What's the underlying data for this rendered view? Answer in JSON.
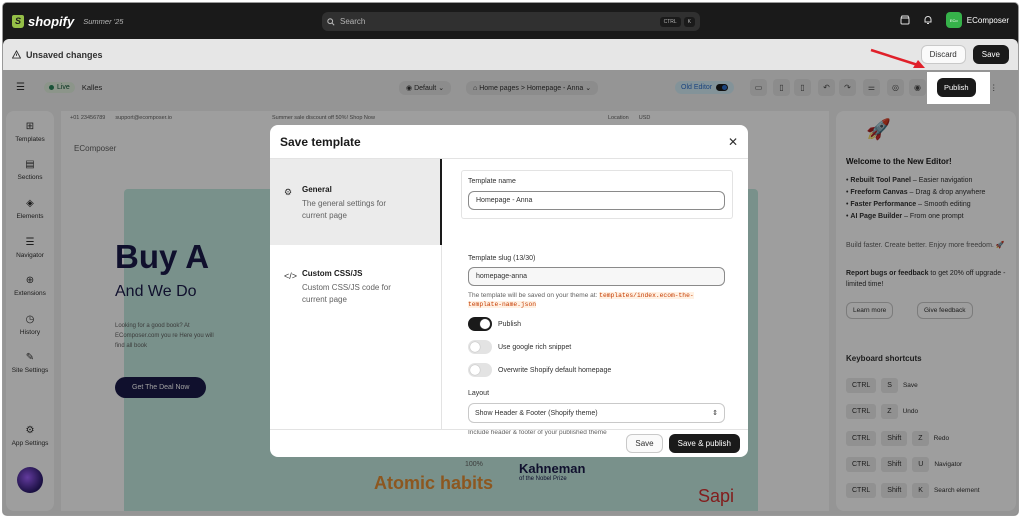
{
  "shopify": {
    "logo_word": "shopify",
    "summer": "Summer '25",
    "search_placeholder": "Search",
    "kbd1": "CTRL",
    "kbd2": "K",
    "store_badge": "ECo",
    "store_name": "EComposer"
  },
  "unsaved": {
    "text": "Unsaved changes",
    "discard": "Discard",
    "save": "Save"
  },
  "toolbar": {
    "live": "Live",
    "theme": "Kalles",
    "default": "Default",
    "breadcrumb": "Home pages > Homepage - Anna",
    "old_editor": "Old Editor",
    "publish": "Publish"
  },
  "sidebar": [
    {
      "label": "Templates",
      "glyph": "⊞"
    },
    {
      "label": "Sections",
      "glyph": "▤"
    },
    {
      "label": "Elements",
      "glyph": "◈"
    },
    {
      "label": "Navigator",
      "glyph": "☰"
    },
    {
      "label": "Extensions",
      "glyph": "⊕"
    },
    {
      "label": "History",
      "glyph": "◷"
    },
    {
      "label": "Site Settings",
      "glyph": "✎"
    },
    {
      "label": "App Settings",
      "glyph": "⚙"
    }
  ],
  "canvas": {
    "phone": "+01 23456789",
    "email": "support@ecomposer.io",
    "promo": "Summer sale discount off 50%! Shop Now",
    "location": "Location",
    "currency": "USD",
    "brand": "EComposer",
    "hero_h1": "Buy A",
    "hero_h2": "And We Do",
    "hero_p": "Looking for a good book? At EComposer.com you re Here you will find all book",
    "deal": "Get The Deal Now",
    "zoom": "100%",
    "book1": "Kahneman",
    "book1_sub": "of the Nobel Prize",
    "book2": "Atomic habits",
    "book3": "Sapi"
  },
  "right_panel": {
    "welcome": "Welcome to the New Editor!",
    "bullets": [
      {
        "bold": "Rebuilt Tool Panel",
        "rest": " – Easier navigation"
      },
      {
        "bold": "Freeform Canvas",
        "rest": " – Drag & drop anywhere"
      },
      {
        "bold": "Faster Performance",
        "rest": " – Smooth editing"
      },
      {
        "bold": "AI Page Builder",
        "rest": " – From one prompt"
      }
    ],
    "tagline": "Build faster. Create better. Enjoy more freedom. 🚀",
    "report": "Report bugs or feedback",
    "report_rest": " to get 20% off upgrade - limited time!",
    "learn_more": "Learn more",
    "give_feedback": "Give feedback",
    "shortcuts_title": "Keyboard shortcuts",
    "shortcuts": [
      {
        "keys": [
          "CTRL",
          "S"
        ],
        "action": "Save"
      },
      {
        "keys": [
          "CTRL",
          "Z"
        ],
        "action": "Undo"
      },
      {
        "keys": [
          "CTRL",
          "Shift",
          "Z"
        ],
        "action": "Redo"
      },
      {
        "keys": [
          "CTRL",
          "Shift",
          "U"
        ],
        "action": "Navigator"
      },
      {
        "keys": [
          "CTRL",
          "Shift",
          "K"
        ],
        "action": "Search element"
      }
    ]
  },
  "modal": {
    "title": "Save template",
    "nav": [
      {
        "title": "General",
        "desc": "The general settings for current page"
      },
      {
        "title": "Custom CSS/JS",
        "desc": "Custom CSS/JS code for current page"
      }
    ],
    "template_name_label": "Template name",
    "template_name_value": "Homepage - Anna",
    "slug_label": "Template slug (13/30)",
    "slug_value": "homepage-anna",
    "hint_pre": "The template will be saved on your theme at:",
    "hint_code": "templates/index.ecom-the-template-name.json",
    "toggles": [
      {
        "label": "Publish",
        "on": true
      },
      {
        "label": "Use google rich snippet",
        "on": false
      },
      {
        "label": "Overwrite Shopify default homepage",
        "on": false
      }
    ],
    "layout_label": "Layout",
    "layout_value": "Show Header & Footer (Shopify theme)",
    "layout_hint": "Include header & footer of your published theme",
    "save": "Save",
    "save_publish": "Save & publish"
  },
  "colors": {
    "accent_dark": "#1a1a1a",
    "hero_bg": "#c3ebe0",
    "arrow": "#e0202a",
    "live_green": "#29845a"
  }
}
